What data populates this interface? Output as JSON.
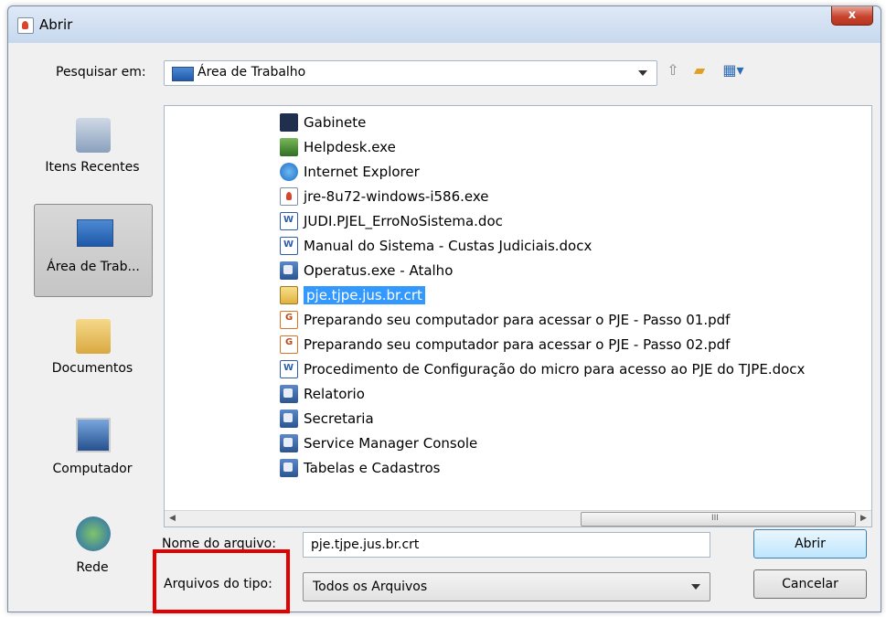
{
  "window": {
    "title": "Abrir",
    "close_label": "x"
  },
  "toolbar": {
    "look_in_label": "Pesquisar em:",
    "look_in_value": "Área de Trabalho",
    "icons": [
      "up-folder-icon",
      "new-folder-icon",
      "view-menu-icon"
    ]
  },
  "places": [
    {
      "label": "Itens Recentes",
      "icon": "recent-items-icon",
      "selected": false
    },
    {
      "label": "Área de Trab...",
      "icon": "desktop-icon",
      "selected": true
    },
    {
      "label": "Documentos",
      "icon": "documents-icon",
      "selected": false
    },
    {
      "label": "Computador",
      "icon": "computer-icon",
      "selected": false
    },
    {
      "label": "Rede",
      "icon": "network-icon",
      "selected": false
    }
  ],
  "files": [
    {
      "name": "Gabinete",
      "icon": "shortcut-icon",
      "selected": false
    },
    {
      "name": "Helpdesk.exe",
      "icon": "exe-icon",
      "selected": false
    },
    {
      "name": "Internet Explorer",
      "icon": "internet-explorer-icon",
      "selected": false
    },
    {
      "name": "jre-8u72-windows-i586.exe",
      "icon": "java-icon",
      "selected": false
    },
    {
      "name": "JUDI.PJEL_ErroNoSistema.doc",
      "icon": "word-doc-icon",
      "selected": false
    },
    {
      "name": "Manual do Sistema - Custas Judiciais.docx",
      "icon": "word-doc-icon",
      "selected": false
    },
    {
      "name": "Operatus.exe - Atalho",
      "icon": "shortcut-icon",
      "selected": false
    },
    {
      "name": "pje.tjpe.jus.br.crt",
      "icon": "certificate-icon",
      "selected": true
    },
    {
      "name": "Preparando seu computador para acessar o PJE - Passo 01.pdf",
      "icon": "pdf-icon",
      "selected": false
    },
    {
      "name": "Preparando seu computador para acessar o PJE - Passo 02.pdf",
      "icon": "pdf-icon",
      "selected": false
    },
    {
      "name": "Procedimento de Configuração do micro para acesso ao PJE do TJPE.docx",
      "icon": "word-doc-icon",
      "selected": false
    },
    {
      "name": "Relatorio",
      "icon": "shortcut-icon",
      "selected": false
    },
    {
      "name": "Secretaria",
      "icon": "shortcut-icon",
      "selected": false
    },
    {
      "name": "Service Manager Console",
      "icon": "shortcut-icon",
      "selected": false
    },
    {
      "name": "Tabelas e Cadastros",
      "icon": "shortcut-icon",
      "selected": false
    }
  ],
  "scrollbar": {
    "grip": "III"
  },
  "filename": {
    "label": "Nome do arquivo:",
    "value": "pje.tjpe.jus.br.crt"
  },
  "filetype": {
    "label": "Arquivos do tipo:",
    "value": "Todos os Arquivos"
  },
  "buttons": {
    "open": "Abrir",
    "cancel": "Cancelar"
  },
  "colors": {
    "selection": "#3399ff",
    "highlight_box": "#e30000"
  }
}
